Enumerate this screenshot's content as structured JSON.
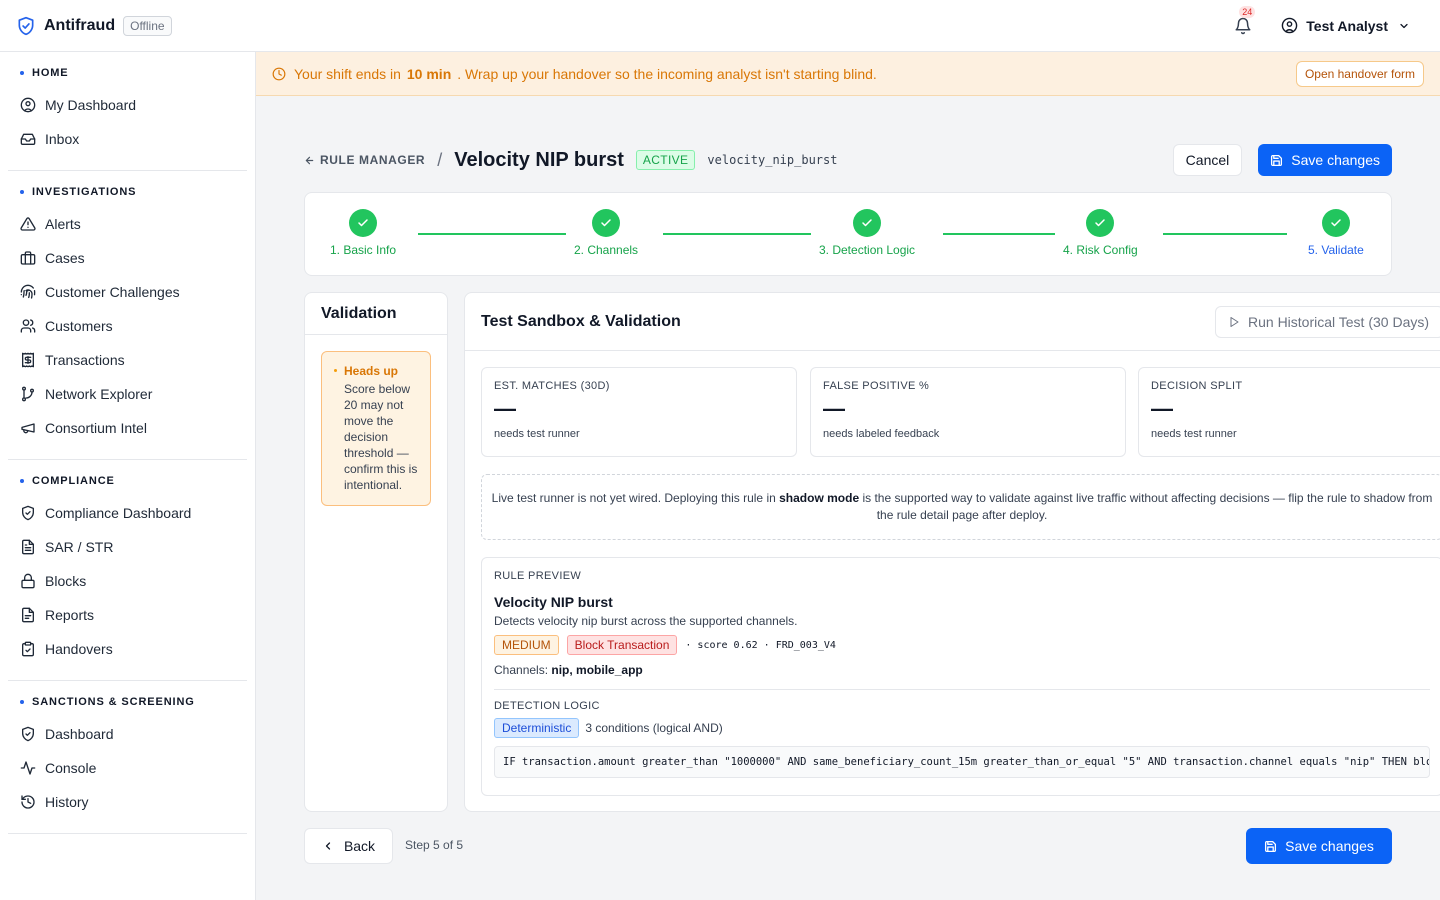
{
  "app": {
    "name": "Antifraud",
    "status": "Offline"
  },
  "notifications": {
    "count": "24"
  },
  "user": {
    "name": "Test Analyst"
  },
  "colors": {
    "accent": "#0b63f6",
    "success": "#22c55e",
    "warning": "#d97706",
    "danger": "#b91c1c"
  },
  "sidebar": {
    "sections": [
      {
        "title": "HOME",
        "items": [
          {
            "label": "My Dashboard",
            "icon": "user-circle-icon"
          },
          {
            "label": "Inbox",
            "icon": "inbox-icon"
          }
        ]
      },
      {
        "title": "INVESTIGATIONS",
        "items": [
          {
            "label": "Alerts",
            "icon": "warning-triangle-icon"
          },
          {
            "label": "Cases",
            "icon": "briefcase-icon"
          },
          {
            "label": "Customer Challenges",
            "icon": "fingerprint-icon"
          },
          {
            "label": "Customers",
            "icon": "users-icon"
          },
          {
            "label": "Transactions",
            "icon": "receipt-icon"
          },
          {
            "label": "Network Explorer",
            "icon": "git-branch-icon"
          },
          {
            "label": "Consortium Intel",
            "icon": "megaphone-icon"
          }
        ]
      },
      {
        "title": "COMPLIANCE",
        "items": [
          {
            "label": "Compliance Dashboard",
            "icon": "shield-check-icon"
          },
          {
            "label": "SAR / STR",
            "icon": "file-text-icon"
          },
          {
            "label": "Blocks",
            "icon": "lock-icon"
          },
          {
            "label": "Reports",
            "icon": "file-icon"
          },
          {
            "label": "Handovers",
            "icon": "clipboard-check-icon"
          }
        ]
      },
      {
        "title": "SANCTIONS & SCREENING",
        "items": [
          {
            "label": "Dashboard",
            "icon": "shield-check-icon"
          },
          {
            "label": "Console",
            "icon": "activity-icon"
          },
          {
            "label": "History",
            "icon": "history-icon"
          }
        ]
      }
    ]
  },
  "banner": {
    "prefix": "Your shift ends in",
    "time": "10 min",
    "suffix": ". Wrap up your handover so the incoming analyst isn't starting blind.",
    "button": "Open handover form"
  },
  "header": {
    "breadcrumb": "RULE MANAGER",
    "separator": "/",
    "title": "Velocity NIP burst",
    "status": "ACTIVE",
    "key": "velocity_nip_burst",
    "cancel_label": "Cancel",
    "save_label": "Save changes"
  },
  "steps": [
    {
      "label": "1. Basic Info",
      "state": "done"
    },
    {
      "label": "2. Channels",
      "state": "done"
    },
    {
      "label": "3. Detection Logic",
      "state": "done"
    },
    {
      "label": "4. Risk Config",
      "state": "done"
    },
    {
      "label": "5. Validate",
      "state": "current"
    }
  ],
  "validation": {
    "title": "Validation",
    "heads_up_title": "Heads up",
    "heads_up_body": "Score below 20 may not move the decision threshold — confirm this is intentional."
  },
  "sandbox": {
    "title": "Test Sandbox & Validation",
    "run_button": "Run Historical Test (30 Days)",
    "stats": [
      {
        "label": "EST. MATCHES (30D)",
        "value": "—",
        "note": "needs test runner"
      },
      {
        "label": "FALSE POSITIVE %",
        "value": "—",
        "note": "needs labeled feedback"
      },
      {
        "label": "DECISION SPLIT",
        "value": "—",
        "note": "needs test runner"
      }
    ],
    "note_pre": "Live test runner is not yet wired. Deploying this rule in ",
    "note_bold": "shadow mode",
    "note_post": " is the supported way to validate against live traffic without affecting decisions — flip the rule to shadow from the rule detail page after deploy."
  },
  "preview": {
    "label": "RULE PREVIEW",
    "name": "Velocity NIP burst",
    "description": "Detects velocity nip burst across the supported channels.",
    "severity": "MEDIUM",
    "action": "Block Transaction",
    "meta": "· score 0.62 · FRD_003_V4",
    "channels_label": "Channels:",
    "channels": "nip, mobile_app",
    "logic_label": "DETECTION LOGIC",
    "logic_type": "Deterministic",
    "logic_summary": "3 conditions (logical AND)",
    "code": "IF transaction.amount greater_than \"1000000\" AND same_beneficiary_count_15m greater_than_or_equal \"5\" AND transaction.channel equals \"nip\" THEN block"
  },
  "footer": {
    "back_label": "Back",
    "step_count": "Step 5 of 5",
    "save_label": "Save changes"
  }
}
